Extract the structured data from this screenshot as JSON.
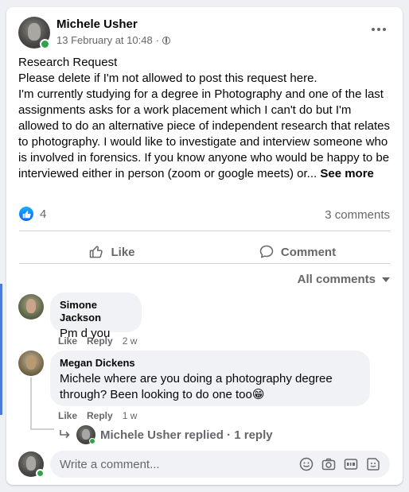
{
  "post": {
    "author": "Michele Usher",
    "timestamp": "13 February at 10:48",
    "separator": "·",
    "paragraphs": [
      "Research Request",
      "Please delete if I'm not allowed to post this request here.",
      "I'm currently studying for a degree in Photography and one of the last assignments asks for a work placement which I can't do but I'm allowed to do an alternative piece of independent research that relates to photography.   I would like to investigate and interview someone who is involved in forensics.  If you know anyone who would be happy to be interviewed either in person (zoom or google meets) or..."
    ],
    "see_more": "See more",
    "reaction_count": "4",
    "comment_count": "3 comments"
  },
  "actions": {
    "like": "Like",
    "comment": "Comment"
  },
  "filter": {
    "label": "All comments"
  },
  "comments": [
    {
      "author": "Simone Jackson",
      "text": "Pm d you",
      "like": "Like",
      "reply": "Reply",
      "age": "2 w"
    },
    {
      "author": "Megan Dickens",
      "text": "Michele where are you doing a photography degree through? Been looking to do one too",
      "emoji": "😁",
      "like": "Like",
      "reply": "Reply",
      "age": "1 w"
    }
  ],
  "replies_summary": {
    "author": "Michele Usher",
    "text": "replied · 1 reply"
  },
  "composer": {
    "placeholder": "Write a comment..."
  },
  "colors": {
    "accent": "#0866ff",
    "online": "#31a24c",
    "thread_marker": "#4a7bd8"
  }
}
